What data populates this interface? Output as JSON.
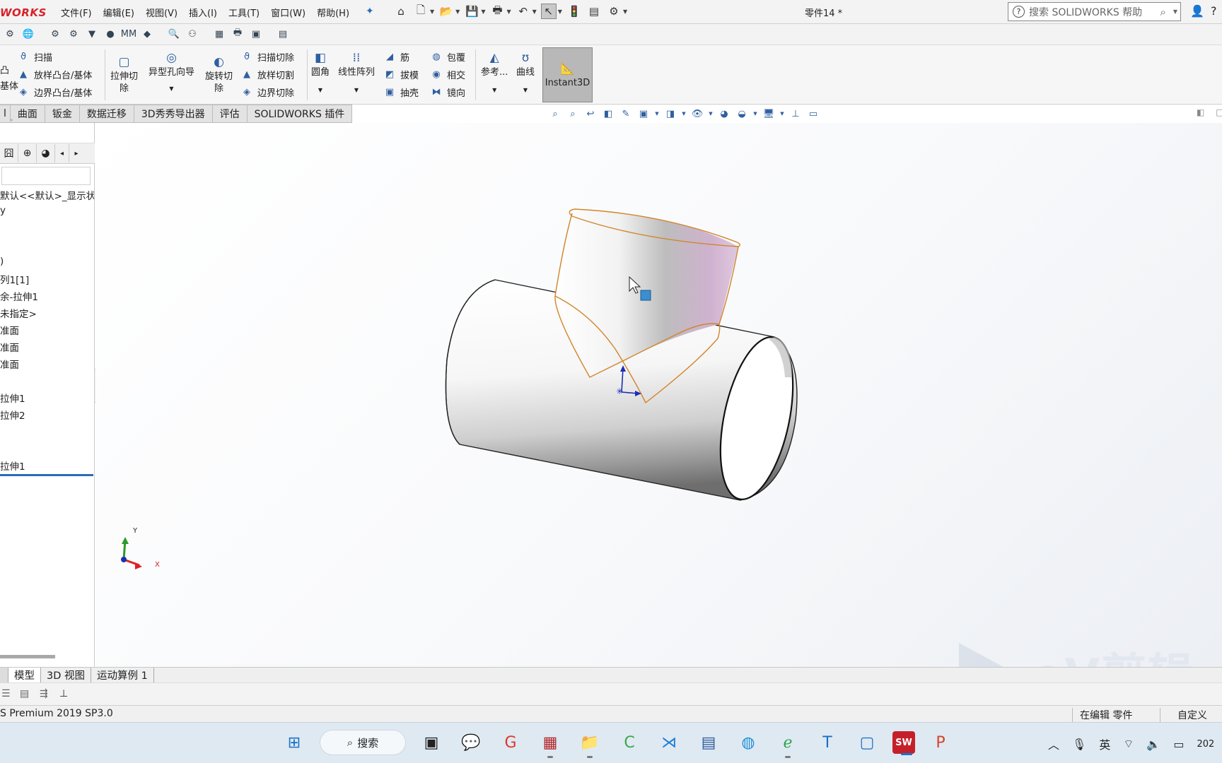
{
  "app": {
    "logo_text": "WORKS",
    "doc_title": "零件14 *",
    "brand_color": "#d8222a"
  },
  "menu": [
    "文件(F)",
    "编辑(E)",
    "视图(V)",
    "插入(I)",
    "工具(T)",
    "窗口(W)",
    "帮助(H)"
  ],
  "help_search": {
    "placeholder": "搜索 SOLIDWORKS 帮助"
  },
  "ribbon": {
    "sweep": "扫描",
    "loft_boss": "放样凸台/基体",
    "boundary_boss": "边界凸台/基体",
    "boss_partial_1": "凸",
    "boss_partial_2": "基体",
    "extruded_cut_1": "拉伸切",
    "extruded_cut_2": "除",
    "hole_wizard": "异型孔向导",
    "revolved_cut_1": "旋转切",
    "revolved_cut_2": "除",
    "swept_cut": "扫描切除",
    "lofted_cut": "放样切割",
    "boundary_cut": "边界切除",
    "fillet": "圆角",
    "linear_pattern": "线性阵列",
    "rib": "筋",
    "draft": "拔模",
    "shell": "抽壳",
    "wrap": "包覆",
    "intersect": "相交",
    "mirror": "镜向",
    "reference": "参考...",
    "curves": "曲线",
    "instant3d": "Instant3D"
  },
  "command_tabs": [
    "曲面",
    "钣金",
    "数据迁移",
    "3D秀秀导出器",
    "评估",
    "SOLIDWORKS 插件"
  ],
  "feature_tree": [
    "默认<<默认>_显示状",
    "y",
    ")",
    "列1[1]",
    "余-拉伸1",
    "未指定>",
    "准面",
    "准面",
    "准面",
    "拉伸1",
    "拉伸2",
    "拉伸1"
  ],
  "triad": {
    "y": "Y",
    "x": "X"
  },
  "watermark": "eV剪辑",
  "bottom_tabs": [
    "模型",
    "3D 视图",
    "运动算例 1"
  ],
  "status": {
    "left": "S Premium 2019 SP3.0",
    "mid": "在编辑 零件",
    "right": "自定义"
  },
  "taskbar": {
    "search_label": "搜索",
    "ime": "英",
    "clock_partial": "202"
  },
  "colors": {
    "edge_orange": "#d2852a",
    "viewport_bg": "#f4f6f9",
    "selection_blue": "#2b6cb5"
  }
}
